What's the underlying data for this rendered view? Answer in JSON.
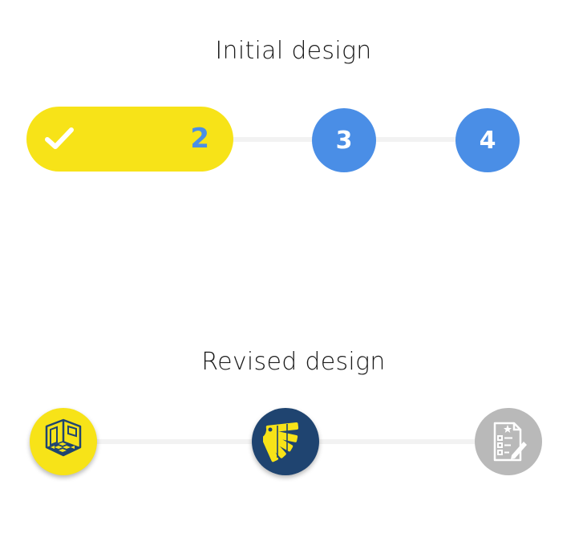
{
  "sections": {
    "initial": {
      "title": "Initial design",
      "completed_step_number": "2",
      "steps": [
        "3",
        "4"
      ]
    },
    "revised": {
      "title": "Revised design",
      "icons": [
        "room-floor-icon",
        "color-swatch-icon",
        "form-checklist-icon"
      ]
    }
  },
  "colors": {
    "yellow": "#f7e318",
    "blue": "#4a8ee6",
    "navy": "#1f4470",
    "gray": "#b9b9b9",
    "track": "#f2f2f2"
  }
}
